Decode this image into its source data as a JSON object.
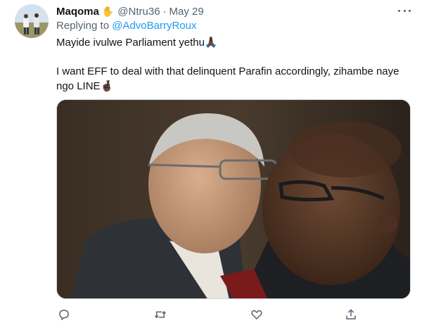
{
  "tweet": {
    "author_name": "Maqoma",
    "author_emoji": "✋",
    "handle": "@Ntru36",
    "separator": "·",
    "date": "May 29",
    "replying_prefix": "Replying to",
    "replying_to": "@AdvoBarryRoux",
    "line1": "Mayide ivulwe Parliament yethu🙏🏿",
    "line2": "I want EFF to deal with that delinquent Parafin accordingly, zihambe naye",
    "line3": "ngo LINE🤞🏿"
  },
  "icons": {
    "more": "more-horizontal-icon",
    "reply": "reply-bubble-icon",
    "retweet": "retweet-icon",
    "like": "heart-icon",
    "share": "share-upload-icon"
  },
  "colors": {
    "text": "#0f1419",
    "secondary": "#536471",
    "link": "#1d9bf0",
    "border": "#cfd9de"
  }
}
